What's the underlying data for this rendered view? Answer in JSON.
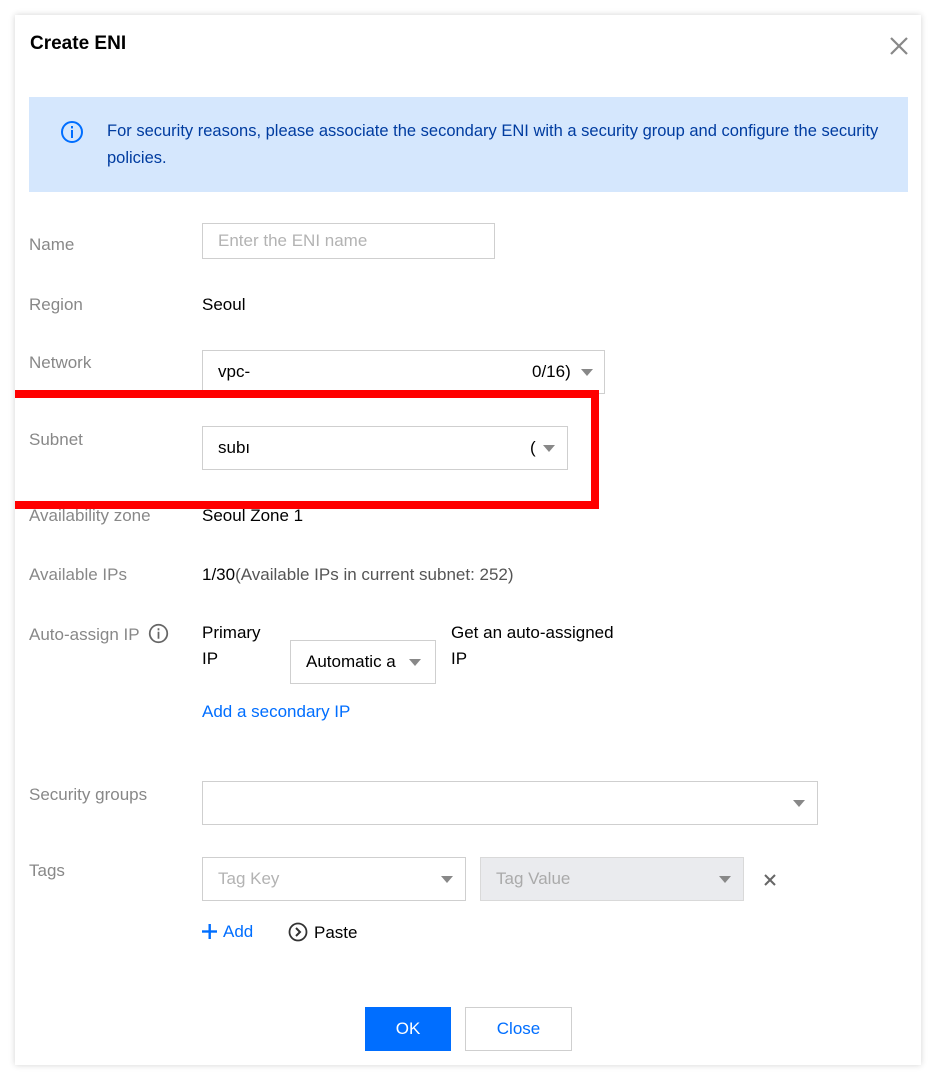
{
  "dialog": {
    "title": "Create ENI",
    "close_icon": "close-icon"
  },
  "banner": {
    "icon": "info-icon",
    "text": "For security reasons, please associate the secondary ENI with a security group and configure the security policies."
  },
  "form": {
    "name": {
      "label": "Name",
      "placeholder": "Enter the ENI name",
      "value": ""
    },
    "region": {
      "label": "Region",
      "value": "Seoul"
    },
    "network": {
      "label": "Network",
      "value_left": "vpc-",
      "value_right": "0/16)"
    },
    "subnet": {
      "label": "Subnet",
      "value_left": "subı",
      "value_right": "("
    },
    "availability_zone": {
      "label": "Availability zone",
      "value": "Seoul Zone 1"
    },
    "available_ips": {
      "label": "Available IPs",
      "value": "1/30",
      "suffix": "(Available IPs in current subnet: 252)"
    },
    "auto_assign_ip": {
      "label": "Auto-assign IP",
      "info_icon": "info-icon",
      "primary_label_line1": "Primary",
      "primary_label_line2": "IP",
      "mode_select": "Automatic a",
      "hint_line1": "Get an auto-assigned",
      "hint_line2": "IP",
      "add_secondary": "Add a secondary IP"
    },
    "security_groups": {
      "label": "Security groups",
      "value": ""
    },
    "tags": {
      "label": "Tags",
      "key_placeholder": "Tag Key",
      "value_placeholder": "Tag Value",
      "remove_icon": "close-icon",
      "add_label": "Add",
      "paste_label": "Paste"
    }
  },
  "footer": {
    "ok_label": "OK",
    "close_label": "Close"
  },
  "colors": {
    "primary": "#006eff",
    "banner_bg": "#d5e7fd",
    "banner_text": "#003ca0",
    "highlight": "#ff0000",
    "label": "#888888"
  }
}
